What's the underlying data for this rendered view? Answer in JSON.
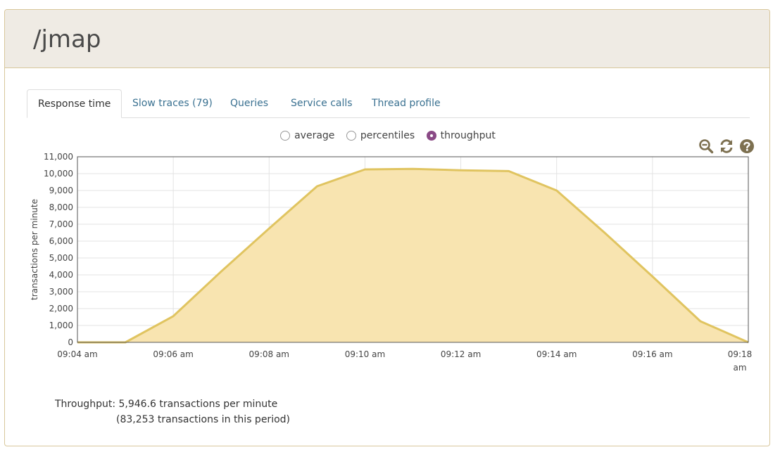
{
  "page": {
    "title": "/jmap"
  },
  "tabs": [
    {
      "label": "Response time",
      "active": true
    },
    {
      "label": "Slow traces (79)",
      "active": false
    },
    {
      "label": "Queries",
      "active": false
    },
    {
      "label": "Service calls",
      "active": false
    },
    {
      "label": "Thread profile",
      "active": false
    }
  ],
  "view_options": [
    {
      "label": "average",
      "checked": false
    },
    {
      "label": "percentiles",
      "checked": false
    },
    {
      "label": "throughput",
      "checked": true
    }
  ],
  "toolbar": {
    "icons": [
      "zoom-out-icon",
      "refresh-icon",
      "help-icon"
    ],
    "icon_color": "#7d7050"
  },
  "chart_data": {
    "type": "area",
    "title": "",
    "ylabel": "transactions per minute",
    "xlabel": "",
    "ylim": [
      0,
      11000
    ],
    "yticks": [
      0,
      1000,
      2000,
      3000,
      4000,
      5000,
      6000,
      7000,
      8000,
      9000,
      10000,
      11000
    ],
    "ytick_labels": [
      "0",
      "1,000",
      "2,000",
      "3,000",
      "4,000",
      "5,000",
      "6,000",
      "7,000",
      "8,000",
      "9,000",
      "10,000",
      "11,000"
    ],
    "xlim": [
      "09:04",
      "09:18"
    ],
    "xtick_labels": [
      "09:04 am",
      "09:06 am",
      "09:08 am",
      "09:10 am",
      "09:12 am",
      "09:14 am",
      "09:16 am",
      "09:18 am"
    ],
    "xtick_times": [
      "09:04",
      "09:06",
      "09:08",
      "09:10",
      "09:12",
      "09:14",
      "09:16",
      "09:18"
    ],
    "grid": true,
    "series": [
      {
        "x": [
          "09:04",
          "09:05",
          "09:06",
          "09:07",
          "09:08",
          "09:09",
          "09:10",
          "09:11",
          "09:12",
          "09:13",
          "09:14",
          "09:15",
          "09:16",
          "09:17",
          "09:18"
        ],
        "values": [
          0,
          0,
          1550,
          4200,
          6750,
          9250,
          10250,
          10280,
          10200,
          10150,
          9000,
          6500,
          3900,
          1250,
          0
        ],
        "color": "#e0c460",
        "fill": "#f8e4b0"
      }
    ]
  },
  "summary": {
    "line1": "Throughput: 5,946.6 transactions per minute",
    "line2": "(83,253 transactions in this period)"
  }
}
